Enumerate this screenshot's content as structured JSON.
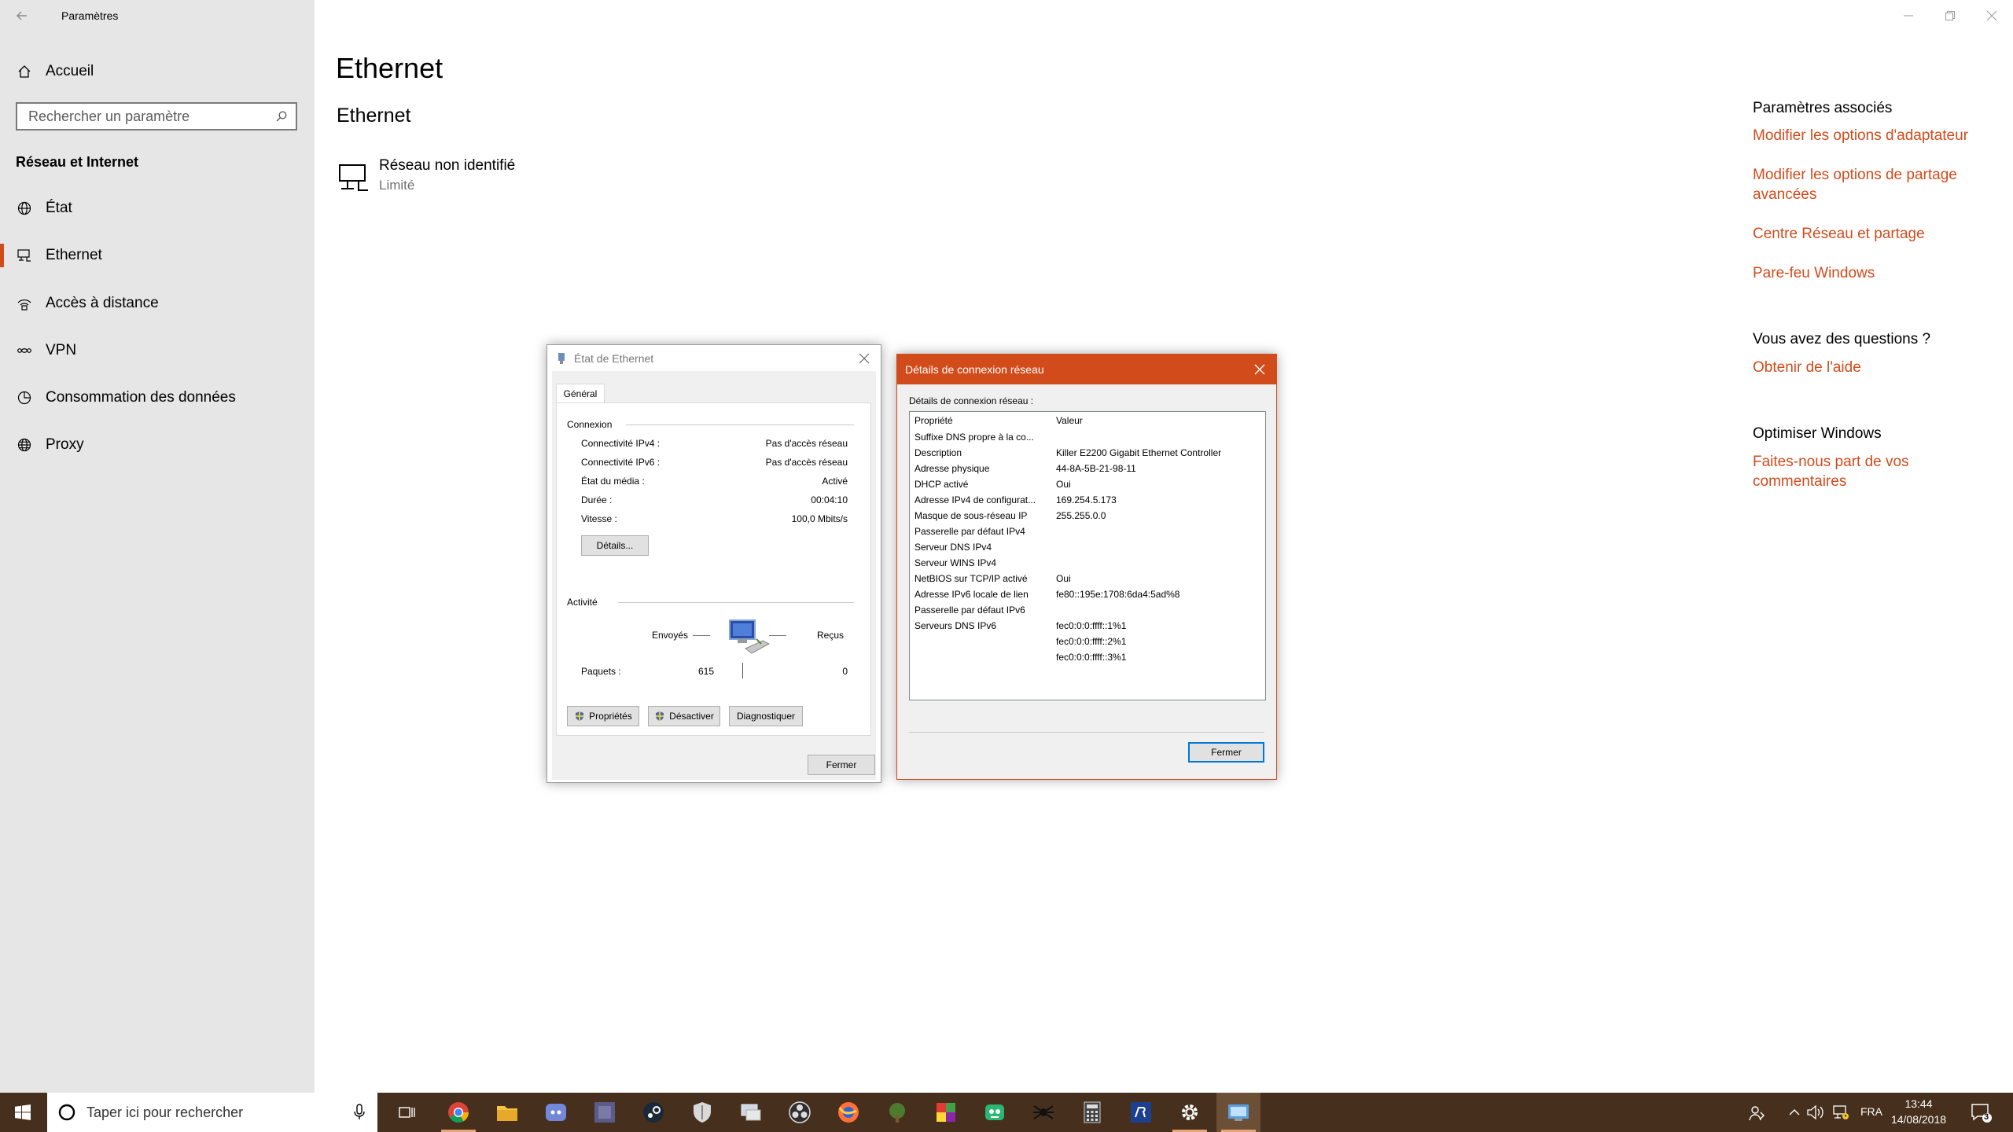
{
  "window": {
    "title": "Paramètres"
  },
  "sidebar": {
    "home": "Accueil",
    "search_placeholder": "Rechercher un paramètre",
    "section": "Réseau et Internet",
    "items": [
      {
        "label": "État",
        "icon": "globe-status-icon"
      },
      {
        "label": "Ethernet",
        "icon": "ethernet-icon",
        "active": true
      },
      {
        "label": "Accès à distance",
        "icon": "dialup-icon"
      },
      {
        "label": "VPN",
        "icon": "vpn-icon"
      },
      {
        "label": "Consommation des données",
        "icon": "data-usage-icon"
      },
      {
        "label": "Proxy",
        "icon": "globe-icon"
      }
    ]
  },
  "main": {
    "page_title": "Ethernet",
    "section_title": "Ethernet",
    "network": {
      "name": "Réseau non identifié",
      "status": "Limité"
    }
  },
  "related": {
    "title": "Paramètres associés",
    "links": [
      "Modifier les options d'adaptateur",
      "Modifier les options de partage avancées",
      "Centre Réseau et partage",
      "Pare-feu Windows"
    ],
    "questions_title": "Vous avez des questions ?",
    "help_link": "Obtenir de l'aide",
    "optimize_title": "Optimiser Windows",
    "feedback_link": "Faites-nous part de vos commentaires"
  },
  "status_dialog": {
    "title": "État de Ethernet",
    "tab": "Général",
    "connection_label": "Connexion",
    "rows": [
      {
        "label": "Connectivité IPv4 :",
        "value": "Pas d'accès réseau"
      },
      {
        "label": "Connectivité IPv6 :",
        "value": "Pas d'accès réseau"
      },
      {
        "label": "État du média :",
        "value": "Activé"
      },
      {
        "label": "Durée :",
        "value": "00:04:10"
      },
      {
        "label": "Vitesse :",
        "value": "100,0 Mbits/s"
      }
    ],
    "details_button": "Détails...",
    "activity_label": "Activité",
    "sent_label": "Envoyés",
    "received_label": "Reçus",
    "packets_label": "Paquets :",
    "packets_sent": "615",
    "packets_received": "0",
    "properties_button": "Propriétés",
    "disable_button": "Désactiver",
    "diagnose_button": "Diagnostiquer",
    "close_button": "Fermer"
  },
  "details_dialog": {
    "title": "Détails de connexion réseau",
    "group_label": "Détails de connexion réseau :",
    "col_property": "Propriété",
    "col_value": "Valeur",
    "rows": [
      {
        "p": "Suffixe DNS propre à la co...",
        "v": ""
      },
      {
        "p": "Description",
        "v": "Killer E2200 Gigabit Ethernet Controller"
      },
      {
        "p": "Adresse physique",
        "v": "44-8A-5B-21-98-11"
      },
      {
        "p": "DHCP activé",
        "v": "Oui"
      },
      {
        "p": "Adresse IPv4 de configurat...",
        "v": "169.254.5.173"
      },
      {
        "p": "Masque de sous-réseau IP",
        "v": "255.255.0.0"
      },
      {
        "p": "Passerelle par défaut IPv4",
        "v": ""
      },
      {
        "p": "Serveur DNS IPv4",
        "v": ""
      },
      {
        "p": "Serveur WINS IPv4",
        "v": ""
      },
      {
        "p": "NetBIOS sur TCP/IP activé",
        "v": "Oui"
      },
      {
        "p": "Adresse IPv6 locale de lien",
        "v": "fe80::195e:1708:6da4:5ad%8"
      },
      {
        "p": "Passerelle par défaut IPv6",
        "v": ""
      },
      {
        "p": "Serveurs DNS IPv6",
        "v": "fec0:0:0:ffff::1%1"
      },
      {
        "p": "",
        "v": "fec0:0:0:ffff::2%1"
      },
      {
        "p": "",
        "v": "fec0:0:0:ffff::3%1"
      }
    ],
    "close_button": "Fermer",
    "accent": "#d24b1b"
  },
  "taskbar": {
    "search_placeholder": "Taper ici pour rechercher",
    "apps": [
      "task-view-icon",
      "chrome-icon",
      "file-explorer-icon",
      "discord-icon",
      "game-icon",
      "steam-icon",
      "shield-app-icon",
      "network-app-icon",
      "obs-icon",
      "firefox-icon",
      "tree-app-icon",
      "color-app-icon",
      "robot-app-icon",
      "spider-app-icon",
      "calculator-icon",
      "rsi-icon",
      "settings-icon",
      "control-panel-icon"
    ],
    "language": "FRA",
    "time": "13:44",
    "date": "14/08/2018",
    "notifications": "3"
  },
  "colors": {
    "accent": "#d24b1b",
    "taskbar": "#462f1c",
    "sidebar": "#e6e6e6"
  }
}
